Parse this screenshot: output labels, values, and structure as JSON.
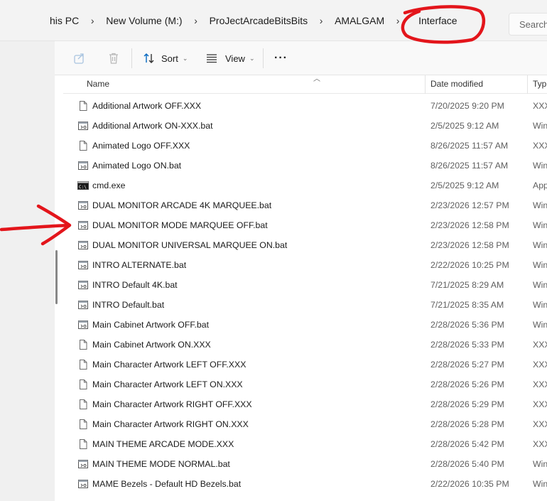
{
  "breadcrumb": {
    "items": [
      "his PC",
      "New Volume (M:)",
      "ProJectArcadeBitsBits",
      "AMALGAM"
    ],
    "current": "Interface"
  },
  "search": {
    "placeholder": "Search"
  },
  "toolbar": {
    "sort_label": "Sort",
    "view_label": "View",
    "more_label": "···"
  },
  "columns": {
    "name": "Name",
    "date_modified": "Date modified",
    "type": "Typ"
  },
  "files": [
    {
      "name": "Additional Artwork OFF.XXX",
      "date": "7/20/2025 9:20 PM",
      "type": "XXX",
      "icon": "file-icon"
    },
    {
      "name": "Additional Artwork ON-XXX.bat",
      "date": "2/5/2025 9:12 AM",
      "type": "Win",
      "icon": "bat-file-icon"
    },
    {
      "name": "Animated Logo OFF.XXX",
      "date": "8/26/2025 11:57 AM",
      "type": "XXX",
      "icon": "file-icon"
    },
    {
      "name": "Animated Logo ON.bat",
      "date": "8/26/2025 11:57 AM",
      "type": "Win",
      "icon": "bat-file-icon"
    },
    {
      "name": "cmd.exe",
      "date": "2/5/2025 9:12 AM",
      "type": "App",
      "icon": "cmd-icon"
    },
    {
      "name": "DUAL MONITOR ARCADE 4K MARQUEE.bat",
      "date": "2/23/2026 12:57 PM",
      "type": "Win",
      "icon": "bat-file-icon"
    },
    {
      "name": "DUAL MONITOR MODE MARQUEE OFF.bat",
      "date": "2/23/2026 12:58 PM",
      "type": "Win",
      "icon": "bat-file-icon"
    },
    {
      "name": "DUAL MONITOR UNIVERSAL MARQUEE ON.bat",
      "date": "2/23/2026 12:58 PM",
      "type": "Win",
      "icon": "bat-file-icon"
    },
    {
      "name": "INTRO ALTERNATE.bat",
      "date": "2/22/2026 10:25 PM",
      "type": "Win",
      "icon": "bat-file-icon"
    },
    {
      "name": "INTRO Default 4K.bat",
      "date": "7/21/2025 8:29 AM",
      "type": "Win",
      "icon": "bat-file-icon"
    },
    {
      "name": "INTRO Default.bat",
      "date": "7/21/2025 8:35 AM",
      "type": "Win",
      "icon": "bat-file-icon"
    },
    {
      "name": "Main Cabinet Artwork OFF.bat",
      "date": "2/28/2026 5:36 PM",
      "type": "Win",
      "icon": "bat-file-icon"
    },
    {
      "name": "Main Cabinet Artwork ON.XXX",
      "date": "2/28/2026 5:33 PM",
      "type": "XXX",
      "icon": "file-icon"
    },
    {
      "name": "Main Character Artwork LEFT OFF.XXX",
      "date": "2/28/2026 5:27 PM",
      "type": "XXX",
      "icon": "file-icon"
    },
    {
      "name": "Main Character Artwork LEFT ON.XXX",
      "date": "2/28/2026 5:26 PM",
      "type": "XXX",
      "icon": "file-icon"
    },
    {
      "name": "Main Character Artwork RIGHT OFF.XXX",
      "date": "2/28/2026 5:29 PM",
      "type": "XXX",
      "icon": "file-icon"
    },
    {
      "name": "Main Character Artwork RIGHT ON.XXX",
      "date": "2/28/2026 5:28 PM",
      "type": "XXX",
      "icon": "file-icon"
    },
    {
      "name": "MAIN THEME ARCADE MODE.XXX",
      "date": "2/28/2026 5:42 PM",
      "type": "XXX",
      "icon": "file-icon"
    },
    {
      "name": "MAIN THEME MODE NORMAL.bat",
      "date": "2/28/2026 5:40 PM",
      "type": "Win",
      "icon": "bat-file-icon"
    },
    {
      "name": "MAME Bezels - Default HD Bezels.bat",
      "date": "2/22/2026 10:35 PM",
      "type": "Win",
      "icon": "bat-file-icon"
    }
  ],
  "colors": {
    "annotation_red": "#e3151b",
    "folder_accent": "#0067c0"
  }
}
